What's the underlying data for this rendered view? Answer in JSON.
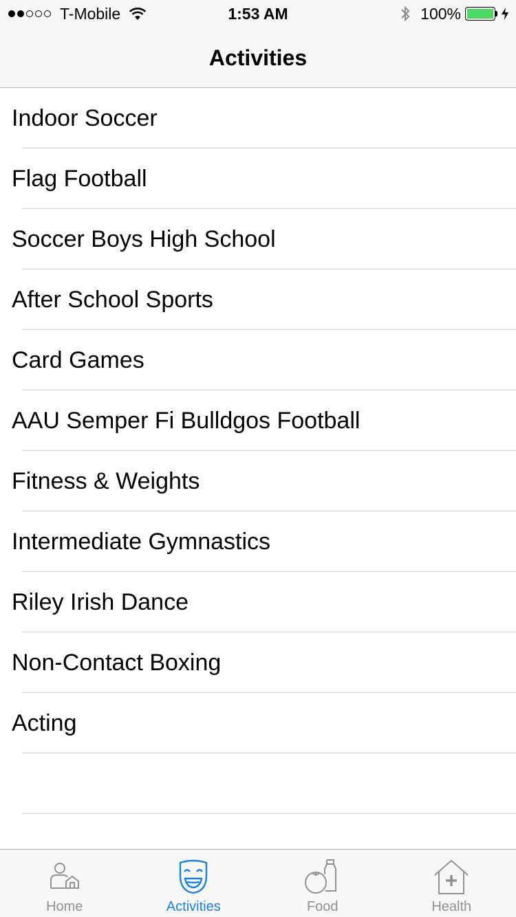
{
  "status_bar": {
    "carrier": "T-Mobile",
    "signal_bars_filled": 2,
    "signal_bars_total": 5,
    "time": "1:53 AM",
    "battery_percent_text": "100%",
    "battery_level": 1.0,
    "battery_color": "#4cd964"
  },
  "nav": {
    "title": "Activities"
  },
  "activities": [
    "Indoor Soccer",
    "Flag Football",
    "Soccer Boys High School",
    "After School Sports",
    "Card Games",
    "AAU Semper Fi Bulldgos Football",
    "Fitness & Weights",
    "Intermediate Gymnastics",
    "Riley Irish Dance",
    "Non-Contact Boxing",
    "Acting"
  ],
  "tab_bar": {
    "active_color": "#1a82e6",
    "inactive_color": "#929292",
    "tabs": [
      {
        "label": "Home",
        "icon": "home-person-icon",
        "active": false
      },
      {
        "label": "Activities",
        "icon": "smiling-mask-icon",
        "active": true
      },
      {
        "label": "Food",
        "icon": "tomato-bottle-icon",
        "active": false
      },
      {
        "label": "Health",
        "icon": "health-house-icon",
        "active": false
      }
    ]
  }
}
